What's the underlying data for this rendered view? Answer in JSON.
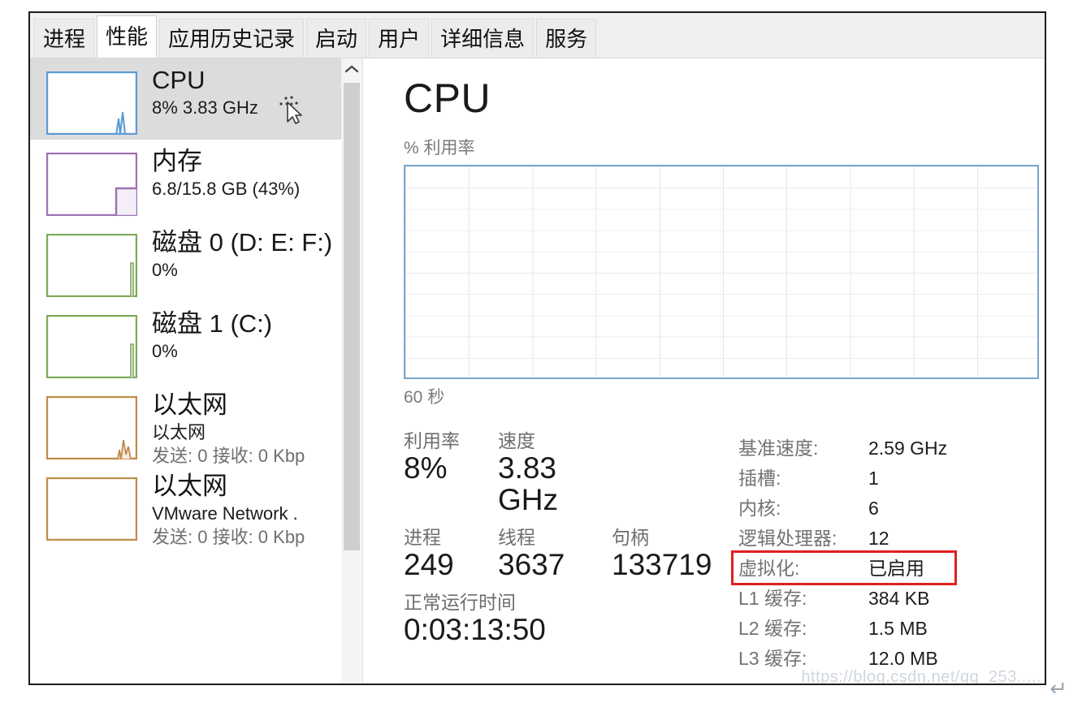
{
  "window": {
    "tabs": [
      {
        "label": "进程",
        "selected": false
      },
      {
        "label": "性能",
        "selected": true
      },
      {
        "label": "应用历史记录",
        "selected": false
      },
      {
        "label": "启动",
        "selected": false
      },
      {
        "label": "用户",
        "selected": false
      },
      {
        "label": "详细信息",
        "selected": false
      },
      {
        "label": "服务",
        "selected": false
      }
    ]
  },
  "sidebar": {
    "items": [
      {
        "title": "CPU",
        "sub1": "8%  3.83 GHz",
        "sub2": "",
        "color": "#5a9bd5",
        "selected": true
      },
      {
        "title": "内存",
        "sub1": "6.8/15.8 GB (43%)",
        "sub2": "",
        "color": "#9b72b0",
        "selected": false
      },
      {
        "title": "磁盘 0 (D: E: F:)",
        "sub1": "0%",
        "sub2": "",
        "color": "#7fa95a",
        "selected": false
      },
      {
        "title": "磁盘 1 (C:)",
        "sub1": "0%",
        "sub2": "",
        "color": "#7fa95a",
        "selected": false
      },
      {
        "title": "以太网",
        "sub1": "以太网",
        "sub2": "发送: 0 接收: 0 Kbp",
        "color": "#c08b4a",
        "selected": false
      },
      {
        "title": "以太网",
        "sub1": "VMware Network .",
        "sub2": "发送: 0 接收: 0 Kbp",
        "color": "#c08b4a",
        "selected": false
      }
    ],
    "scrollbar": {
      "up_arrow": "chevron-up-icon"
    }
  },
  "main": {
    "title": "CPU",
    "graph_caption": "% 利用率",
    "graph_foot": "60 秒",
    "stats": [
      [
        {
          "label": "利用率",
          "value": "8%",
          "width": "w1"
        },
        {
          "label": "速度",
          "value": "3.83 GHz",
          "width": "w2"
        }
      ],
      [
        {
          "label": "进程",
          "value": "249",
          "width": "w1"
        },
        {
          "label": "线程",
          "value": "3637",
          "width": "w3"
        },
        {
          "label": "句柄",
          "value": "133719",
          "width": "w3"
        }
      ]
    ],
    "uptime": {
      "label": "正常运行时间",
      "value": "0:03:13:50"
    },
    "specs": [
      {
        "key": "基准速度:",
        "value": "2.59 GHz",
        "highlight": false
      },
      {
        "key": "插槽:",
        "value": "1",
        "highlight": false
      },
      {
        "key": "内核:",
        "value": "6",
        "highlight": false
      },
      {
        "key": "逻辑处理器:",
        "value": "12",
        "highlight": false
      },
      {
        "key": "虚拟化:",
        "value": "已启用",
        "highlight": true
      },
      {
        "key": "L1 缓存:",
        "value": "384 KB",
        "highlight": false
      },
      {
        "key": "L2 缓存:",
        "value": "1.5 MB",
        "highlight": false
      },
      {
        "key": "L3 缓存:",
        "value": "12.0 MB",
        "highlight": false
      }
    ],
    "highlight_color": "#e02020"
  },
  "chart_data": {
    "type": "line",
    "title": "% 利用率",
    "xlabel": "60 秒",
    "ylabel": "% 利用率",
    "ylim": [
      0,
      100
    ],
    "xlim": [
      0,
      60
    ],
    "grid": true,
    "legend": "none",
    "x": [],
    "values": [],
    "note": "CPU 利用率历史图（图内无可见数据曲线，仅网格）"
  },
  "watermark": {
    "text": "https://blog.csdn.net/qq_253.....",
    "glyph": "↵"
  }
}
